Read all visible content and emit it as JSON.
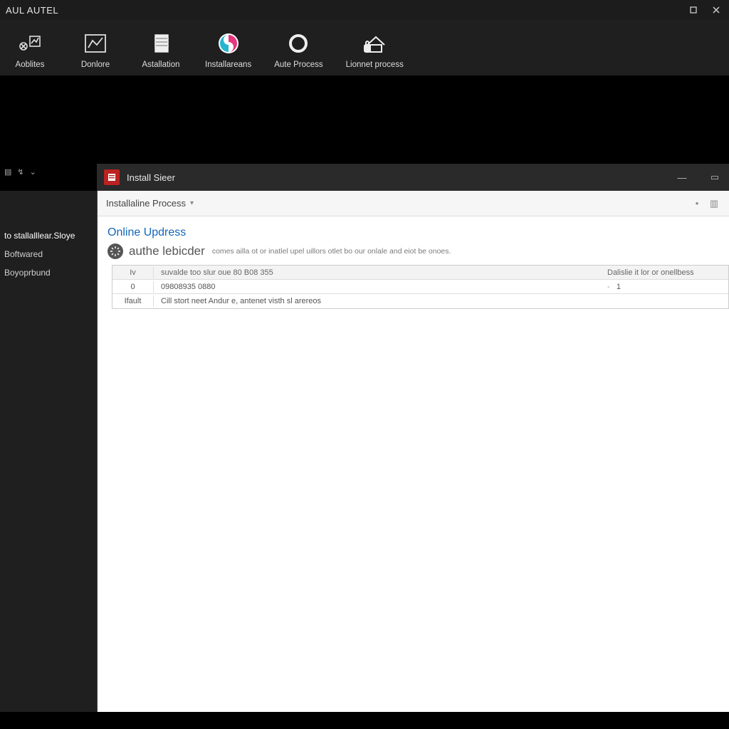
{
  "titlebar": {
    "title": "AUL  AUTEL"
  },
  "ribbon": [
    {
      "id": "applites",
      "label": "Aoblites"
    },
    {
      "id": "donlore",
      "label": "Donlore"
    },
    {
      "id": "astallation",
      "label": "Astallation"
    },
    {
      "id": "installareans",
      "label": "Installareans"
    },
    {
      "id": "auteprocess",
      "label": "Aute Process"
    },
    {
      "id": "lionnetprocess",
      "label": "Lionnet process"
    }
  ],
  "subwindow": {
    "title": "Install Sieer"
  },
  "breadcrumb": {
    "label": "Installaline Process"
  },
  "leftNav": {
    "items": [
      {
        "label": "to stallalllear.Sloye"
      },
      {
        "label": "Boftwared"
      },
      {
        "label": "Boyoprbund"
      }
    ]
  },
  "section": {
    "title": "Online Updress",
    "subTitle": "authe lebicder",
    "desc": "comes ailla ot or inatlel upel uillors otlet bo our onlale and eiot be onoes."
  },
  "table": {
    "headers": {
      "c0": "Iv",
      "c1": "suvalde too slur oue 80 B08 355",
      "c2": "Dalislie it lor or onellbess"
    },
    "rows": [
      {
        "c0": "0",
        "c1": "09808935 0880",
        "c2dash": "-",
        "c2": "1"
      },
      {
        "c0": "Ifault",
        "c1": "Cill stort neet Andur e, antenet visth sl arereos",
        "c2dash": "",
        "c2": ""
      }
    ]
  }
}
